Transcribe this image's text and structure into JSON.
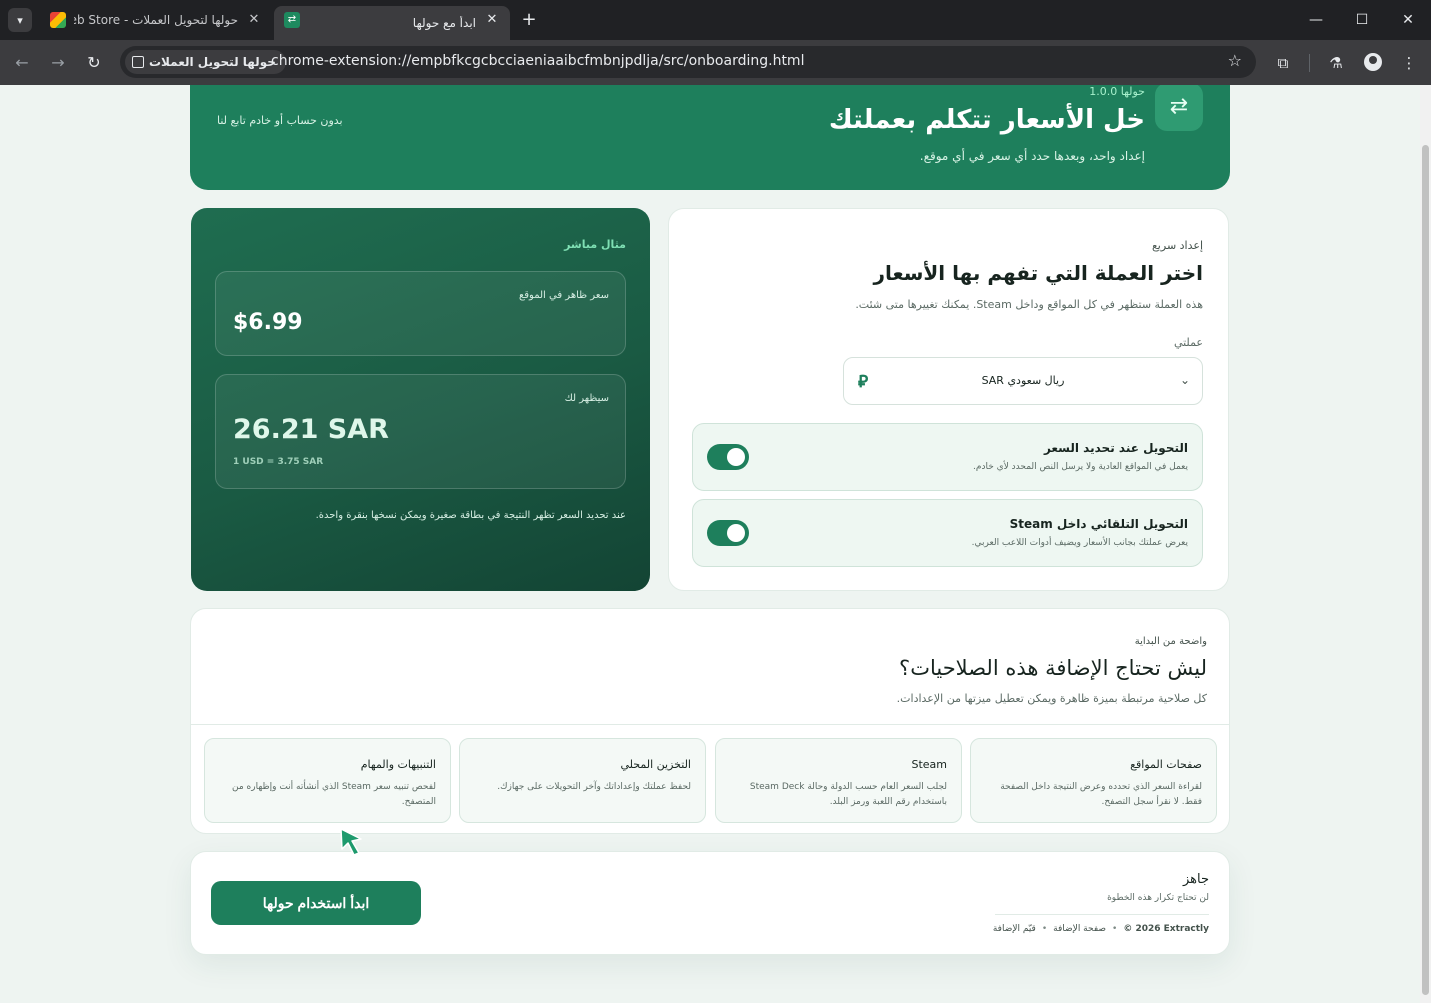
{
  "browser": {
    "tab_menu_icon": "chevron-down-icon",
    "tabs": [
      {
        "title": "حولها لتحويل العملات - Chrome Web Store",
        "close": "✕",
        "icon": "chrome-web-store-icon"
      },
      {
        "title": "ابدأ مع حولها",
        "close": "✕",
        "icon": "swap-arrows-icon"
      }
    ],
    "new_tab": "+",
    "window_controls": {
      "minimize": "—",
      "maximize": "☐",
      "close": "✕"
    },
    "nav": {
      "back": "←",
      "forward": "→",
      "reload": "↻"
    },
    "chip_label": "حولها لتحويل العملات",
    "url": "chrome-extension://empbfkcgcbcciaeniaaibcfmbnjpdlja/src/onboarding.html",
    "star": "☆",
    "toolbar_icons": {
      "extensions": "⧉",
      "labs": "⚗",
      "menu": "⋮"
    }
  },
  "hero": {
    "icon": "⇄",
    "version": "حولها 1.0.0",
    "title": "خل الأسعار تتكلم بعملتك",
    "subtitle": "إعداد واحد، وبعدها حدد أي سعر في أي موقع.",
    "note": "بدون حساب أو خادم تابع لنا"
  },
  "setup": {
    "eyebrow": "إعداد سريع",
    "title": "اختر العملة التي تفهم بها الأسعار",
    "description": "هذه العملة ستظهر في كل المواقع وداخل Steam. يمكنك تغييرها متى شئت.",
    "currency_label": "عملتي",
    "currency_value": "ريال سعودي SAR",
    "currency_symbol": "⃁",
    "select_chevron": "⌄",
    "toggles": [
      {
        "title": "التحويل عند تحديد السعر",
        "desc": "يعمل في المواقع العادية ولا يرسل النص المحدد لأي خادم.",
        "on": true
      },
      {
        "title": "التحويل التلقائي داخل Steam",
        "desc": "يعرض عملتك بجانب الأسعار ويضيف أدوات اللاعب العربي.",
        "on": true
      }
    ]
  },
  "demo": {
    "eyebrow": "مثال مباشر",
    "site_label": "سعر ظاهر في الموقع",
    "site_value": "$6.99",
    "result_label": "سيظهر لك",
    "result_value": "26.21 SAR",
    "rate": "1 USD = 3.75 SAR",
    "note": "عند تحديد السعر تظهر النتيجة في بطاقة صغيرة ويمكن نسخها بنقرة واحدة."
  },
  "permissions": {
    "eyebrow": "واضحة من البداية",
    "title": "ليش تحتاج الإضافة هذه الصلاحيات؟",
    "description": "كل صلاحية مرتبطة بميزة ظاهرة ويمكن تعطيل ميزتها من الإعدادات.",
    "items": [
      {
        "title": "صفحات المواقع",
        "desc": "لقراءة السعر الذي تحدده وعرض النتيجة داخل الصفحة فقط. لا نقرأ سجل التصفح."
      },
      {
        "title": "Steam",
        "desc": "لجلب السعر العام حسب الدولة وحالة Steam Deck باستخدام رقم اللعبة ورمز البلد."
      },
      {
        "title": "التخزين المحلي",
        "desc": "لحفظ عملتك وإعداداتك وآخر التحويلات على جهازك."
      },
      {
        "title": "التنبيهات والمهام",
        "desc": "لفحص تنبيه سعر Steam الذي أنشأته أنت وإظهاره من المتصفح."
      }
    ]
  },
  "ready": {
    "title": "جاهز",
    "subtitle": "لن تحتاج تكرار هذه الخطوة",
    "cta": "ابدأ استخدام حولها",
    "footer": {
      "copyright": "© 2026 Extractly",
      "store_page": "صفحة الإضافة",
      "rate": "قيّم الإضافة",
      "separator": "•"
    }
  }
}
